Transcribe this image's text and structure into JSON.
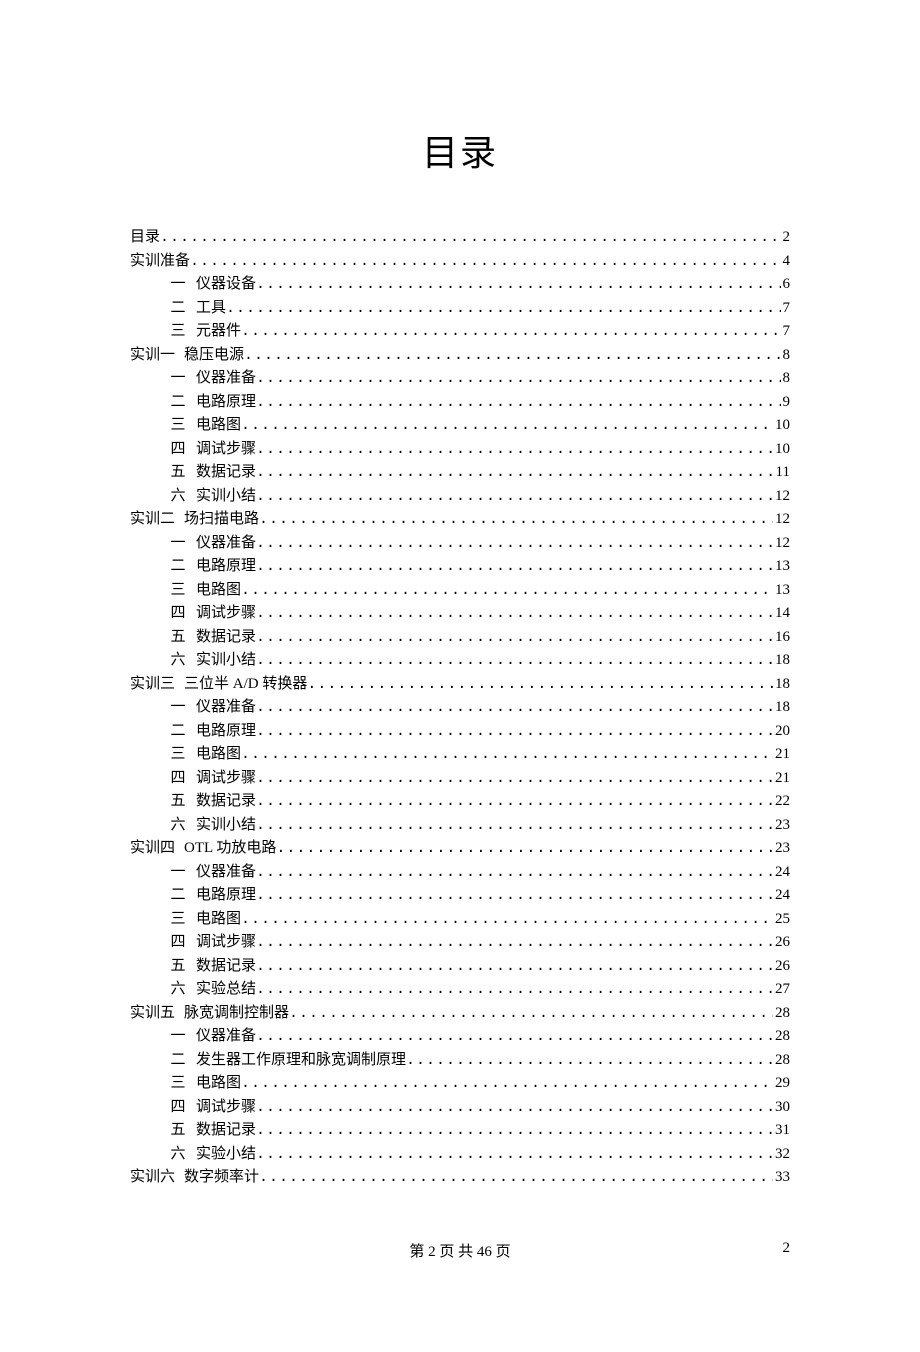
{
  "title": "目录",
  "toc": [
    {
      "level": 0,
      "num": "",
      "label": "目录",
      "page": "2"
    },
    {
      "level": 0,
      "num": "",
      "label": "实训准备",
      "page": "4"
    },
    {
      "level": 1,
      "num": "一",
      "label": "仪器设备",
      "page": "6"
    },
    {
      "level": 1,
      "num": "二",
      "label": "工具",
      "page": "7"
    },
    {
      "level": 1,
      "num": "三",
      "label": "元器件",
      "page": "7"
    },
    {
      "level": 0,
      "num": "实训一",
      "label": "稳压电源",
      "page": "8"
    },
    {
      "level": 1,
      "num": "一",
      "label": "仪器准备",
      "page": "8"
    },
    {
      "level": 1,
      "num": "二",
      "label": "电路原理",
      "page": "9"
    },
    {
      "level": 1,
      "num": "三",
      "label": "电路图",
      "page": "10"
    },
    {
      "level": 1,
      "num": "四",
      "label": "调试步骤",
      "page": "10"
    },
    {
      "level": 1,
      "num": "五",
      "label": "数据记录",
      "page": "11"
    },
    {
      "level": 1,
      "num": "六",
      "label": "实训小结",
      "page": "12"
    },
    {
      "level": 0,
      "num": "实训二",
      "label": "场扫描电路",
      "page": "12"
    },
    {
      "level": 1,
      "num": "一",
      "label": "仪器准备",
      "page": "12"
    },
    {
      "level": 1,
      "num": "二",
      "label": "电路原理",
      "page": "13"
    },
    {
      "level": 1,
      "num": "三",
      "label": "电路图",
      "page": "13"
    },
    {
      "level": 1,
      "num": "四",
      "label": "调试步骤",
      "page": "14"
    },
    {
      "level": 1,
      "num": "五",
      "label": "数据记录",
      "page": "16"
    },
    {
      "level": 1,
      "num": "六",
      "label": "实训小结",
      "page": "18"
    },
    {
      "level": 0,
      "num": "实训三",
      "label": "三位半 A/D 转换器",
      "page": "18"
    },
    {
      "level": 1,
      "num": "一",
      "label": "仪器准备",
      "page": "18"
    },
    {
      "level": 1,
      "num": "二",
      "label": "电路原理",
      "page": "20"
    },
    {
      "level": 1,
      "num": "三",
      "label": "电路图",
      "page": "21"
    },
    {
      "level": 1,
      "num": "四",
      "label": "调试步骤",
      "page": "21"
    },
    {
      "level": 1,
      "num": "五",
      "label": "数据记录",
      "page": "22"
    },
    {
      "level": 1,
      "num": "六",
      "label": "实训小结",
      "page": "23"
    },
    {
      "level": 0,
      "num": "实训四",
      "label": "OTL 功放电路",
      "page": "23"
    },
    {
      "level": 1,
      "num": "一",
      "label": "仪器准备",
      "page": "24"
    },
    {
      "level": 1,
      "num": "二",
      "label": "电路原理",
      "page": "24"
    },
    {
      "level": 1,
      "num": "三",
      "label": "电路图",
      "page": "25"
    },
    {
      "level": 1,
      "num": "四",
      "label": "调试步骤",
      "page": "26"
    },
    {
      "level": 1,
      "num": "五",
      "label": "数据记录",
      "page": "26"
    },
    {
      "level": 1,
      "num": "六",
      "label": "实验总结",
      "page": "27"
    },
    {
      "level": 0,
      "num": "实训五",
      "label": "脉宽调制控制器",
      "page": "28"
    },
    {
      "level": 1,
      "num": "一",
      "label": "仪器准备",
      "page": "28"
    },
    {
      "level": 1,
      "num": "二",
      "label": "发生器工作原理和脉宽调制原理",
      "page": "28"
    },
    {
      "level": 1,
      "num": "三",
      "label": "电路图",
      "page": "29"
    },
    {
      "level": 1,
      "num": "四",
      "label": "调试步骤",
      "page": "30"
    },
    {
      "level": 1,
      "num": "五",
      "label": "数据记录",
      "page": "31"
    },
    {
      "level": 1,
      "num": "六",
      "label": "实验小结",
      "page": "32"
    },
    {
      "level": 0,
      "num": "实训六",
      "label": "数字频率计",
      "page": "33"
    }
  ],
  "footer": {
    "center": "第 2 页 共 46 页",
    "right": "2"
  }
}
